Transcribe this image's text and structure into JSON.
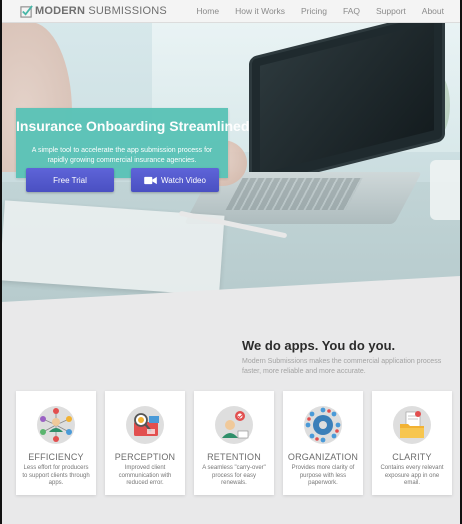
{
  "brand": {
    "name_bold": "MODERN",
    "name_rest": " SUBMISSIONS",
    "logo_icon": "checkmark-icon"
  },
  "nav": {
    "items": [
      "Home",
      "How it Works",
      "Pricing",
      "FAQ",
      "Support",
      "About"
    ]
  },
  "hero": {
    "title": "Insurance Onboarding Streamlined",
    "subtitle": "A simple tool to accelerate the app submission process for rapidly growing commercial insurance agencies.",
    "trial_label": "Free Trial",
    "video_label": "Watch Video",
    "video_icon": "video-camera-icon"
  },
  "apps": {
    "title": "We do apps. You do you.",
    "description": "Modern Submissions makes the commercial application process faster, more reliable and more accurate."
  },
  "features": [
    {
      "title": "EFFICIENCY",
      "text": "Less effort for producers to support clients through apps.",
      "icon": "efficiency-network-icon"
    },
    {
      "title": "PERCEPTION",
      "text": "Improved client communication with reduced error.",
      "icon": "perception-search-icon"
    },
    {
      "title": "RETENTION",
      "text": "A seamless \"carry-over\" process for easy renewals.",
      "icon": "retention-user-icon"
    },
    {
      "title": "ORGANIZATION",
      "text": "Provides more clarity of purpose with less paperwork.",
      "icon": "organization-gear-icon"
    },
    {
      "title": "CLARITY",
      "text": "Contains every relevant exposure app in one email.",
      "icon": "clarity-folder-icon"
    }
  ],
  "colors": {
    "accent_teal": "#5bc3b7",
    "button_blue": "#5359cf",
    "page_bg": "#e9e9ea"
  }
}
